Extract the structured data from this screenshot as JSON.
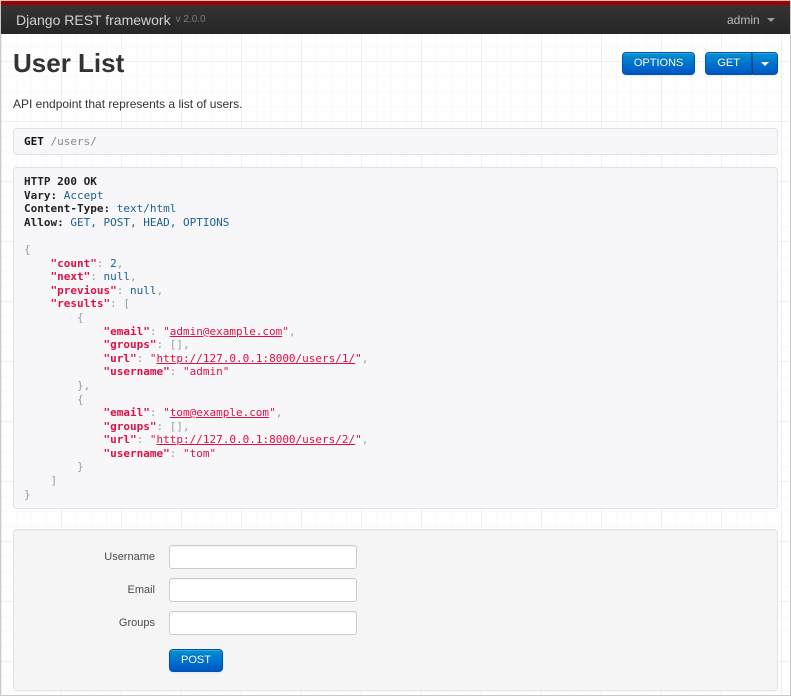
{
  "navbar": {
    "brand": "Django REST framework",
    "version": "v 2.0.0",
    "user_menu_label": "admin"
  },
  "header": {
    "title": "User List",
    "description": "API endpoint that represents a list of users.",
    "options_button_label": "OPTIONS",
    "get_button_label": "GET"
  },
  "request": {
    "method": "GET",
    "path": "/users/"
  },
  "response": {
    "status_line": "HTTP 200 OK",
    "headers": [
      {
        "name": "Vary:",
        "value": "Accept"
      },
      {
        "name": "Content-Type:",
        "value": "text/html"
      },
      {
        "name": "Allow:",
        "value": "GET, POST, HEAD, OPTIONS"
      }
    ],
    "body": {
      "count": 2,
      "next": null,
      "previous": null,
      "results": [
        {
          "email": "admin@example.com",
          "groups": [],
          "url": "http://127.0.0.1:8000/users/1/",
          "username": "admin"
        },
        {
          "email": "tom@example.com",
          "groups": [],
          "url": "http://127.0.0.1:8000/users/2/",
          "username": "tom"
        }
      ]
    },
    "link_fields": [
      "email",
      "url"
    ]
  },
  "form": {
    "fields": [
      {
        "label": "Username",
        "value": ""
      },
      {
        "label": "Email",
        "value": ""
      },
      {
        "label": "Groups",
        "value": ""
      }
    ],
    "submit_label": "POST"
  },
  "colors": {
    "accent_red": "#a30000",
    "navbar_bg": "#2e2e2e",
    "button_blue": "#0088cc",
    "json_string": "#dd1144",
    "json_literal": "#195f91",
    "json_punctuation": "#93a1a1"
  },
  "icons": {
    "caret_down": "▾"
  }
}
